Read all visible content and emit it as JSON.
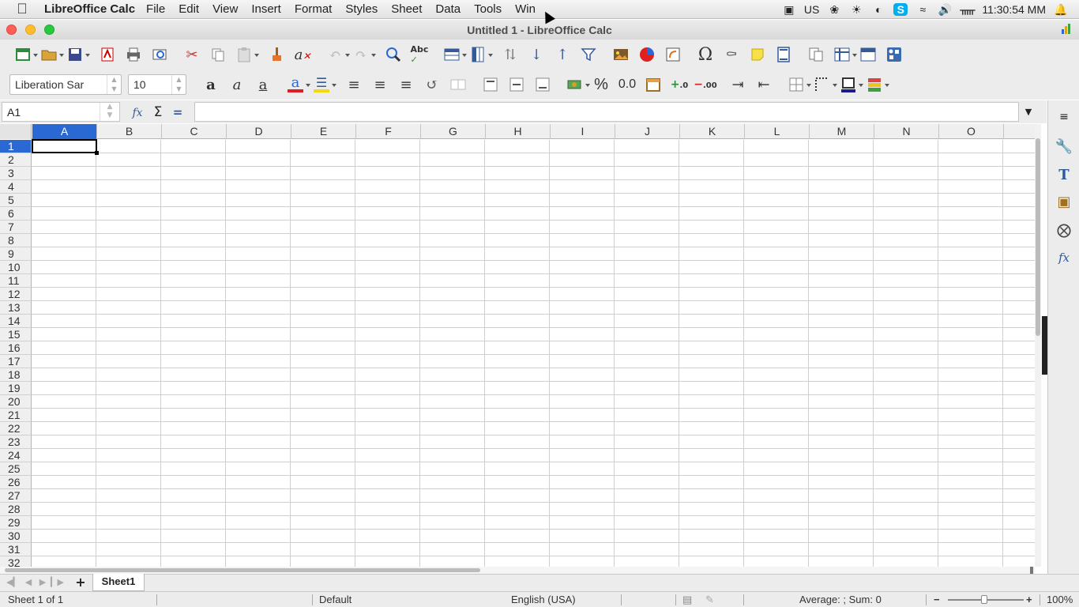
{
  "menubar": {
    "app_name": "LibreOffice Calc",
    "items": [
      "File",
      "Edit",
      "View",
      "Insert",
      "Format",
      "Styles",
      "Sheet",
      "Data",
      "Tools",
      "Win"
    ],
    "keyboard_layout": "US",
    "clock": "11:30:54 MM"
  },
  "window": {
    "title": "Untitled 1 - LibreOffice Calc"
  },
  "toolbar": {
    "font_name": "Liberation Sar",
    "font_size": "10",
    "percent_label": "%",
    "number_label": "0.0"
  },
  "formula_bar": {
    "cell_reference": "A1",
    "formula": ""
  },
  "grid": {
    "columns": [
      "A",
      "B",
      "C",
      "D",
      "E",
      "F",
      "G",
      "H",
      "I",
      "J",
      "K",
      "L",
      "M",
      "N",
      "O"
    ],
    "rows": [
      "1",
      "2",
      "3",
      "4",
      "5",
      "6",
      "7",
      "8",
      "9",
      "10",
      "11",
      "12",
      "13",
      "14",
      "15",
      "16",
      "17",
      "18",
      "19",
      "20",
      "21",
      "22",
      "23",
      "24",
      "25",
      "26",
      "27",
      "28",
      "29",
      "30",
      "31",
      "32"
    ],
    "selected_column": "A",
    "selected_row": "1"
  },
  "sheets": {
    "tabs": [
      "Sheet1"
    ]
  },
  "statusbar": {
    "sheet_position": "Sheet 1 of 1",
    "page_style": "Default",
    "language": "English (USA)",
    "selection_summary": "Average: ; Sum: 0",
    "zoom": "100%"
  },
  "colors": {
    "selection": "#2a68d4",
    "font_color": "#e01b24",
    "highlight": "#f5d90a"
  }
}
